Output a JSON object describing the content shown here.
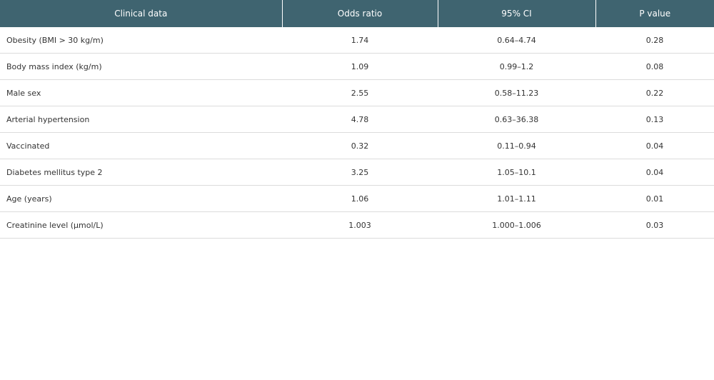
{
  "table": {
    "headers": [
      "Clinical data",
      "Odds ratio",
      "95% CI",
      "P value"
    ],
    "rows": [
      [
        "Obesity (BMI > 30 kg/m)",
        "1.74",
        "0.64–4.74",
        "0.28"
      ],
      [
        "Body mass index (kg/m)",
        "1.09",
        "0.99–1.2",
        "0.08"
      ],
      [
        "Male sex",
        "2.55",
        "0.58–11.23",
        "0.22"
      ],
      [
        "Arterial hypertension",
        "4.78",
        "0.63–36.38",
        "0.13"
      ],
      [
        "Vaccinated",
        "0.32",
        "0.11–0.94",
        "0.04"
      ],
      [
        "Diabetes mellitus type 2",
        "3.25",
        "1.05–10.1",
        "0.04"
      ],
      [
        "Age (years)",
        "1.06",
        "1.01–1.11",
        "0.01"
      ],
      [
        "Creatinine level (µmol/L)",
        "1.003",
        "1.000–1.006",
        "0.03"
      ]
    ],
    "colors": {
      "header_bg": "#3f6470",
      "header_text": "#ffffff",
      "row_divider": "#dcdcdc"
    }
  }
}
